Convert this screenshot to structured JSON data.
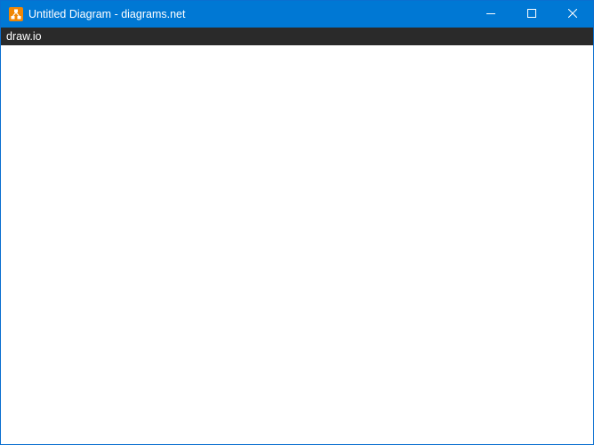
{
  "window": {
    "title": "Untitled Diagram - diagrams.net",
    "app_icon": "drawio-logo-icon",
    "controls": [
      "minimize-icon",
      "maximize-icon",
      "close-icon"
    ]
  },
  "menubar": {
    "label": "draw.io"
  },
  "colors": {
    "titlebar": "#0078d4",
    "menubar": "#2a2a2a",
    "icon_orange": "#f08705",
    "content": "#ffffff"
  }
}
